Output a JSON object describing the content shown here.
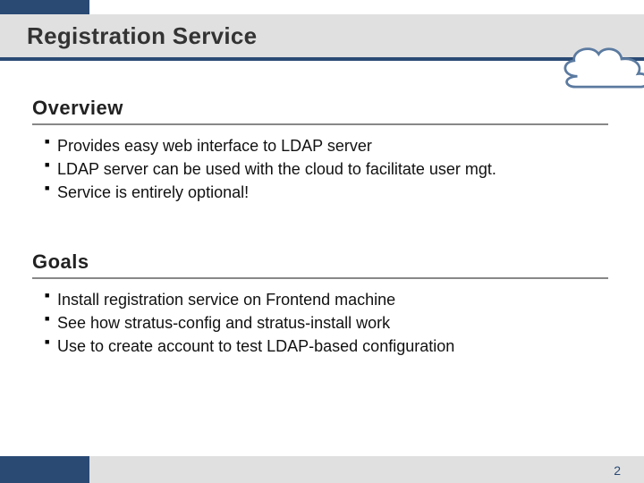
{
  "title": "Registration Service",
  "sections": [
    {
      "heading": "Overview",
      "bullets": [
        "Provides easy web interface to LDAP server",
        "LDAP server can be used with the cloud to facilitate user mgt.",
        "Service is entirely optional!"
      ]
    },
    {
      "heading": "Goals",
      "bullets": [
        "Install registration service on Frontend machine",
        "See how stratus-config and stratus-install work",
        "Use to create account to test LDAP-based configuration"
      ]
    }
  ],
  "page_number": "2",
  "colors": {
    "accent": "#2a4a74",
    "band": "#e0e0e0"
  }
}
